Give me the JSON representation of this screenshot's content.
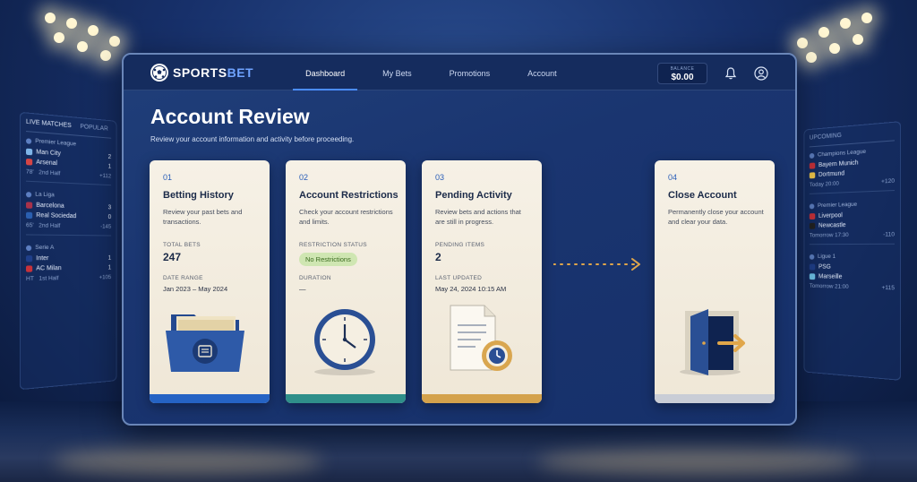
{
  "app": {
    "logo_main": "SPORTS",
    "logo_accent": "BET"
  },
  "nav": {
    "items": [
      {
        "label": "Dashboard",
        "active": true
      },
      {
        "label": "My Bets",
        "active": false
      },
      {
        "label": "Promotions",
        "active": false
      },
      {
        "label": "Account",
        "active": false
      }
    ]
  },
  "balance": {
    "label": "BALANCE",
    "value": "$0.00"
  },
  "page": {
    "title": "Account Review",
    "subtitle": "Review your account information and activity before proceeding."
  },
  "cards": [
    {
      "number": "01",
      "title": "Betting History",
      "description": "Review your past bets and transactions.",
      "stat1_label": "TOTAL BETS",
      "stat1_value": "247",
      "stat2_label": "DATE RANGE",
      "stat2_value": "Jan 2023 – May 2024",
      "accent": "#2563c4",
      "icon": "folder-icon"
    },
    {
      "number": "02",
      "title": "Account Restrictions",
      "description": "Check your account restrictions and limits.",
      "stat1_label": "RESTRICTION STATUS",
      "badge": "No Restrictions",
      "stat2_label": "DURATION",
      "stat2_value": "—",
      "accent": "#2f8f8a",
      "icon": "clock-icon"
    },
    {
      "number": "03",
      "title": "Pending Activity",
      "description": "Review bets and actions that are still in progress.",
      "stat1_label": "PENDING ITEMS",
      "stat1_value": "2",
      "stat2_label": "LAST UPDATED",
      "stat2_value": "May 24, 2024   10:15 AM",
      "accent": "#d4a24c",
      "icon": "pending-document-icon"
    },
    {
      "number": "04",
      "title": "Close Account",
      "description": "Permanently close your account and clear your data.",
      "accent": "#c9cdd6",
      "icon": "exit-door-icon"
    }
  ],
  "left_panel": {
    "tabs": [
      "LIVE MATCHES",
      "POPULAR"
    ],
    "groups": [
      {
        "league": "Premier League",
        "teams": [
          {
            "name": "Man City",
            "score": "2"
          },
          {
            "name": "Arsenal",
            "score": "1"
          }
        ],
        "time": "78'",
        "period": "2nd Half",
        "odds": "+112"
      },
      {
        "league": "La Liga",
        "teams": [
          {
            "name": "Barcelona",
            "score": "3"
          },
          {
            "name": "Real Sociedad",
            "score": "0"
          }
        ],
        "time": "65'",
        "period": "2nd Half",
        "odds": "-145"
      },
      {
        "league": "Serie A",
        "teams": [
          {
            "name": "Inter",
            "score": "1"
          },
          {
            "name": "AC Milan",
            "score": "1"
          }
        ],
        "time": "HT",
        "period": "1st Half",
        "odds": "+105"
      }
    ]
  },
  "right_panel": {
    "tabs": [
      "UPCOMING"
    ],
    "groups": [
      {
        "league": "Champions League",
        "teams": [
          {
            "name": "Bayern Munich"
          },
          {
            "name": "Dortmund"
          }
        ],
        "time": "Today 20:00",
        "odds": "+120"
      },
      {
        "league": "Premier League",
        "teams": [
          {
            "name": "Liverpool"
          },
          {
            "name": "Newcastle"
          }
        ],
        "time": "Tomorrow 17:30",
        "odds": "-110"
      },
      {
        "league": "Ligue 1",
        "teams": [
          {
            "name": "PSG"
          },
          {
            "name": "Marseille"
          }
        ],
        "time": "Tomorrow 21:00",
        "odds": "+115"
      }
    ]
  },
  "colors": {
    "brand_blue": "#4b8dff",
    "window_bg": "#1a3570"
  }
}
